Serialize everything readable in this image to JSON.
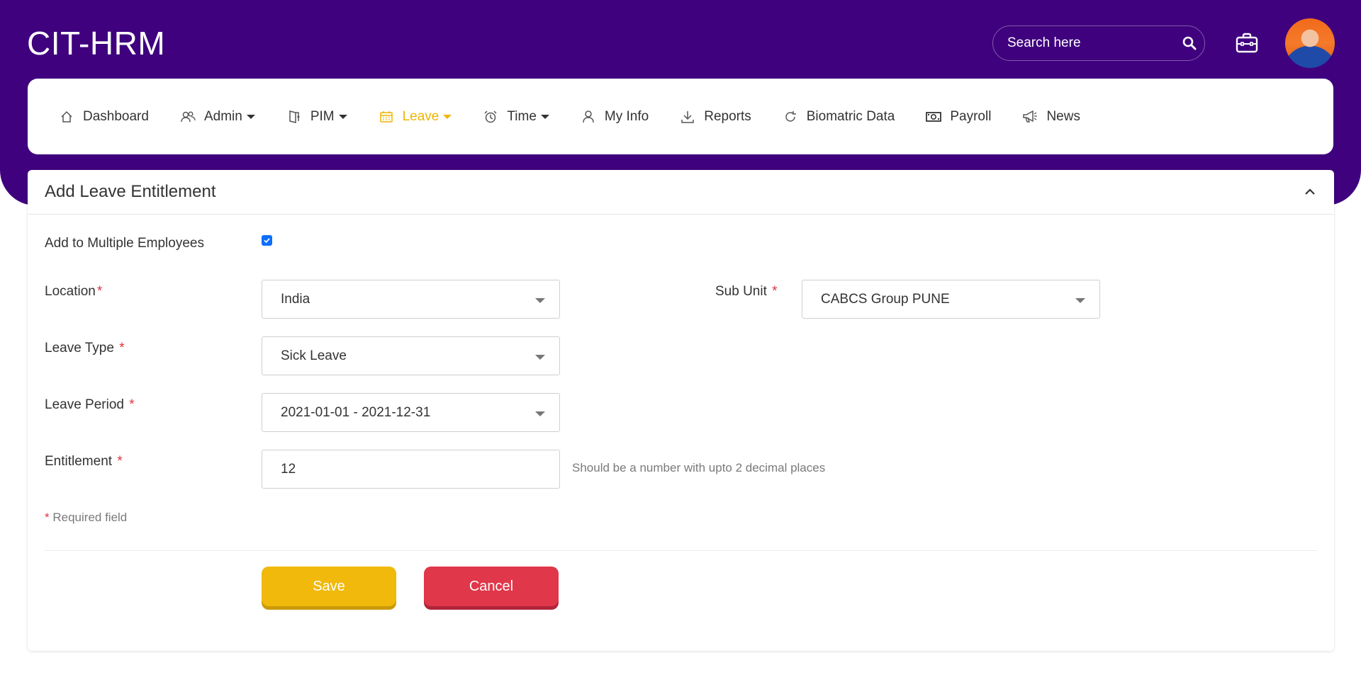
{
  "app": {
    "title": "CIT-HRM"
  },
  "search": {
    "placeholder": "Search here"
  },
  "nav": {
    "items": [
      {
        "label": "Dashboard",
        "icon": "home-icon",
        "dropdown": false,
        "active": false
      },
      {
        "label": "Admin",
        "icon": "users-icon",
        "dropdown": true,
        "active": false
      },
      {
        "label": "PIM",
        "icon": "door-icon",
        "dropdown": true,
        "active": false
      },
      {
        "label": "Leave",
        "icon": "calendar-icon",
        "dropdown": true,
        "active": true
      },
      {
        "label": "Time",
        "icon": "alarm-clock-icon",
        "dropdown": true,
        "active": false
      },
      {
        "label": "My Info",
        "icon": "user-icon",
        "dropdown": false,
        "active": false
      },
      {
        "label": "Reports",
        "icon": "download-icon",
        "dropdown": false,
        "active": false
      },
      {
        "label": "Biomatric Data",
        "icon": "refresh-icon",
        "dropdown": false,
        "active": false
      },
      {
        "label": "Payroll",
        "icon": "money-icon",
        "dropdown": false,
        "active": false
      },
      {
        "label": "News",
        "icon": "megaphone-icon",
        "dropdown": false,
        "active": false
      }
    ]
  },
  "form": {
    "title": "Add Leave Entitlement",
    "multiple_employees_label": "Add to Multiple Employees",
    "multiple_employees_checked": true,
    "location_label": "Location",
    "location_value": "India",
    "sub_unit_label": "Sub Unit",
    "sub_unit_value": "CABCS Group PUNE",
    "leave_type_label": "Leave Type",
    "leave_type_value": "Sick Leave",
    "leave_period_label": "Leave Period",
    "leave_period_value": "2021-01-01 - 2021-12-31",
    "entitlement_label": "Entitlement",
    "entitlement_value": "12",
    "entitlement_hint": "Should be a number with upto 2 decimal places",
    "required_star": "*",
    "required_note": "Required field",
    "save_label": "Save",
    "cancel_label": "Cancel"
  },
  "colors": {
    "header_bg": "#3f017e",
    "active_nav": "#f0b400",
    "save_button": "#f0b90b",
    "cancel_button": "#e0374a",
    "required": "#e03140"
  }
}
